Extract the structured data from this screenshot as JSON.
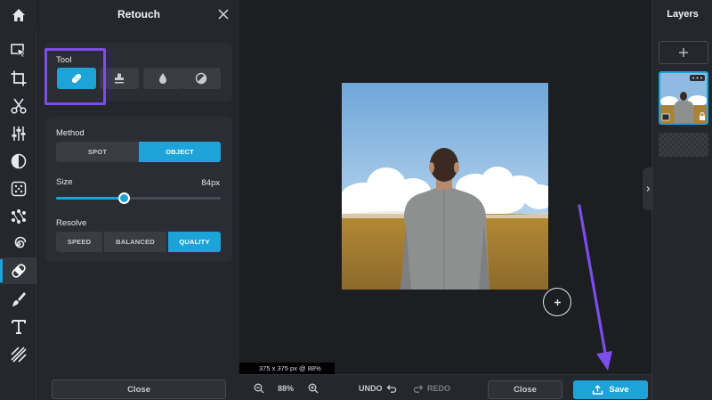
{
  "panel": {
    "title": "Retouch",
    "tool_label": "Tool",
    "tools": [
      {
        "icon": "bandage-icon",
        "active": true
      },
      {
        "icon": "stamp-icon",
        "active": false
      },
      {
        "icon": "drop-icon",
        "active": false
      },
      {
        "icon": "contrast-icon",
        "active": false
      }
    ],
    "method_label": "Method",
    "method_options": [
      "SPOT",
      "OBJECT"
    ],
    "method_selected": "OBJECT",
    "size_label": "Size",
    "size_value": "84px",
    "size_fraction": 0.41,
    "resolve_label": "Resolve",
    "resolve_options": [
      "SPEED",
      "BALANCED",
      "QUALITY"
    ],
    "resolve_selected": "QUALITY",
    "close_label": "Close"
  },
  "toolbar": {
    "icons": [
      "home-icon",
      "select-arrow-icon",
      "crop-icon",
      "scissors-icon",
      "adjust-sliders-icon",
      "half-circle-icon",
      "dots-grid-icon",
      "nodes-icon",
      "spiral-icon",
      "bandage-icon",
      "brush-icon",
      "text-icon",
      "hatch-icon"
    ],
    "active": "bandage-icon"
  },
  "canvas": {
    "dimension_label": "375 x 375 px @ 88%"
  },
  "bottom": {
    "zoom": "88%",
    "undo_label": "UNDO",
    "redo_label": "REDO",
    "close_label": "Close",
    "save_label": "Save"
  },
  "layers": {
    "title": "Layers"
  },
  "colors": {
    "accent": "#1ea3d9",
    "highlight": "#7c4dea",
    "annotation_arrow": "#7c4dea"
  }
}
